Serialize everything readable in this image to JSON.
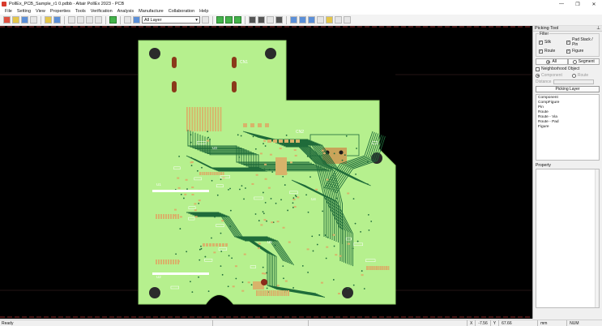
{
  "window": {
    "title": "PollEx_PCB_Sample_r1 0.pdbb - Altair PollEx 2023 - PCB",
    "minimize": "—",
    "maximize": "❐",
    "close": "✕"
  },
  "menu": [
    "File",
    "Setting",
    "View",
    "Properties",
    "Tools",
    "Verification",
    "Analysis",
    "Manufacture",
    "Collaboration",
    "Help"
  ],
  "toolbar": {
    "layer_select_value": "All Layer"
  },
  "board": {
    "silk_labels": {
      "cn1": "CN1",
      "cn2": "CN2",
      "u1": "U1",
      "u2": "U2",
      "u3": "U3",
      "u4": "U4",
      "u5": "U5"
    },
    "colors": {
      "board": "#b6f08e",
      "copper": "#d8b36a",
      "route": "#1f6b3a",
      "background": "#000000",
      "outline": "#d84a4a"
    }
  },
  "picking_tool": {
    "title": "Picking Tool",
    "pin_icon": "pin-icon",
    "filter": {
      "label": "Filter",
      "silk": "Silk",
      "route": "Route",
      "pad_stack": "Pad Stack / Pin",
      "figure": "Figure"
    },
    "mode": {
      "all": "All",
      "segment": "Segment"
    },
    "neighborhood": {
      "label": "Neighborhood Object",
      "component": "Component",
      "route": "Route",
      "distance": "Distance"
    },
    "picking_layer": "Picking Layer",
    "objects": [
      "Component",
      "CompFigure",
      "Pin",
      "Route",
      "Route - Via",
      "Route - Pad",
      "Figure"
    ],
    "property": "Property"
  },
  "status": {
    "ready": "Ready",
    "x_label": "X",
    "x": "-7.56",
    "y_label": "Y",
    "y": "67.66",
    "unit": "mm",
    "num": "NUM"
  }
}
